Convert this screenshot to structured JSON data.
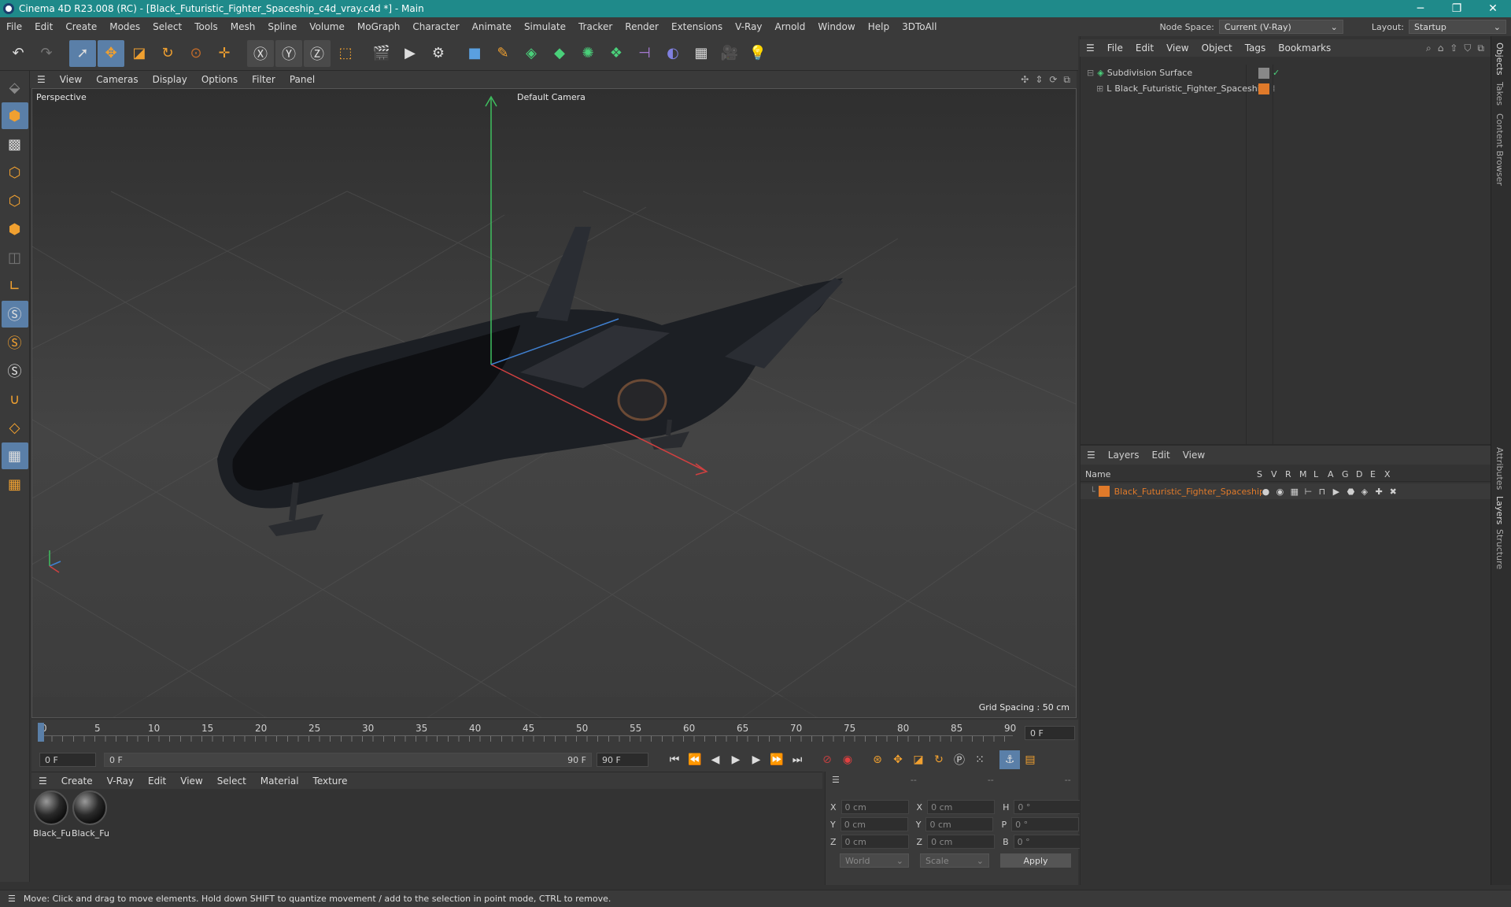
{
  "titlebar": {
    "title": "Cinema 4D R23.008 (RC) - [Black_Futuristic_Fighter_Spaceship_c4d_vray.c4d *] - Main",
    "minimize": "─",
    "restore": "❐",
    "close": "✕"
  },
  "menubar": {
    "items": [
      "File",
      "Edit",
      "Create",
      "Modes",
      "Select",
      "Tools",
      "Mesh",
      "Spline",
      "Volume",
      "MoGraph",
      "Character",
      "Animate",
      "Simulate",
      "Tracker",
      "Render",
      "Extensions",
      "V-Ray",
      "Arnold",
      "Window",
      "Help",
      "3DToAll"
    ],
    "node_space_label": "Node Space:",
    "node_space_value": "Current (V-Ray)",
    "layout_label": "Layout:",
    "layout_value": "Startup"
  },
  "viewport_menu": {
    "items": [
      "View",
      "Cameras",
      "Display",
      "Options",
      "Filter",
      "Panel"
    ]
  },
  "viewport": {
    "view_name": "Perspective",
    "camera": "Default Camera",
    "grid_spacing": "Grid Spacing : 50 cm"
  },
  "timeline": {
    "ticks": [
      "0",
      "5",
      "10",
      "15",
      "20",
      "25",
      "30",
      "35",
      "40",
      "45",
      "50",
      "55",
      "60",
      "65",
      "70",
      "75",
      "80",
      "85",
      "90"
    ],
    "current_frame": "0 F"
  },
  "transport": {
    "start": "0 F",
    "range_start": "0 F",
    "range_end": "90 F",
    "end": "90 F"
  },
  "material_menu": {
    "items": [
      "Create",
      "V-Ray",
      "Edit",
      "View",
      "Select",
      "Material",
      "Texture"
    ]
  },
  "materials": [
    {
      "label": "Black_Fu"
    },
    {
      "label": "Black_Fu"
    }
  ],
  "coords": {
    "headers": [
      "--",
      "--",
      "--"
    ],
    "rows": [
      {
        "a": "X",
        "av": "0 cm",
        "b": "X",
        "bv": "0 cm",
        "c": "H",
        "cv": "0 °"
      },
      {
        "a": "Y",
        "av": "0 cm",
        "b": "Y",
        "bv": "0 cm",
        "c": "P",
        "cv": "0 °"
      },
      {
        "a": "Z",
        "av": "0 cm",
        "b": "Z",
        "bv": "0 cm",
        "c": "B",
        "cv": "0 °"
      }
    ],
    "space": "World",
    "mode": "Scale",
    "apply": "Apply"
  },
  "objects": {
    "menu": [
      "File",
      "Edit",
      "View",
      "Object",
      "Tags",
      "Bookmarks"
    ],
    "items": [
      {
        "name": "Subdivision Surface"
      },
      {
        "name": "Black_Futuristic_Fighter_Spaceship"
      }
    ]
  },
  "layers": {
    "menu": [
      "Layers",
      "Edit",
      "View"
    ],
    "col_name": "Name",
    "flags": [
      "S",
      "V",
      "R",
      "M",
      "L",
      "A",
      "G",
      "D",
      "E",
      "X"
    ],
    "items": [
      {
        "name": "Black_Futuristic_Fighter_Spaceship",
        "color": "#e07a2a"
      }
    ]
  },
  "right_tabs": [
    "Objects",
    "Takes",
    "Content Browser",
    "Attributes",
    "Layers",
    "Structure"
  ],
  "status": "Move: Click and drag to move elements. Hold down SHIFT to quantize movement / add to the selection in point mode, CTRL to remove.",
  "colors": {
    "accent": "#5a7fa8",
    "layer": "#e07a2a",
    "title": "#1f8a8a"
  }
}
